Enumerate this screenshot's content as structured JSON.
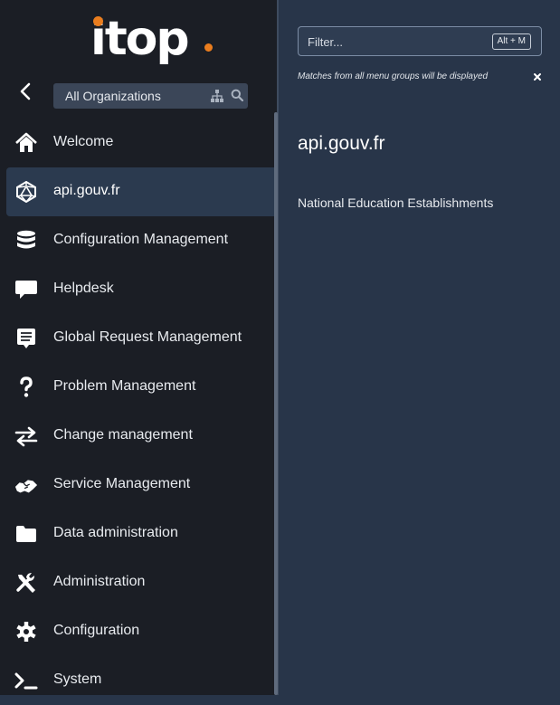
{
  "logo": {
    "text": "itop"
  },
  "org_selector": {
    "label": "All Organizations"
  },
  "menu": {
    "items": [
      {
        "label": "Welcome",
        "icon": "home-icon"
      },
      {
        "label": "api.gouv.fr",
        "icon": "network-icon",
        "active": true
      },
      {
        "label": "Configuration Management",
        "icon": "database-icon"
      },
      {
        "label": "Helpdesk",
        "icon": "speech-bubble-icon"
      },
      {
        "label": "Global Request Management",
        "icon": "comment-list-icon"
      },
      {
        "label": "Problem Management",
        "icon": "question-icon"
      },
      {
        "label": "Change management",
        "icon": "exchange-arrows-icon"
      },
      {
        "label": "Service Management",
        "icon": "handshake-icon"
      },
      {
        "label": "Data administration",
        "icon": "folder-icon"
      },
      {
        "label": "Administration",
        "icon": "tools-icon"
      },
      {
        "label": "Configuration",
        "icon": "gear-icon"
      },
      {
        "label": "System",
        "icon": "terminal-icon"
      }
    ]
  },
  "filter": {
    "placeholder": "Filter...",
    "hotkey": "Alt + M",
    "hint": "Matches from all menu groups will be displayed"
  },
  "menu_group_panel": {
    "title": "api.gouv.fr",
    "entries": [
      "National Education Establishments"
    ]
  },
  "colors": {
    "sidebar_bg": "#1b1e25",
    "main_bg": "#283549",
    "active_item_bg": "#2b3a4f",
    "brand_accent": "#ea7d1e"
  }
}
